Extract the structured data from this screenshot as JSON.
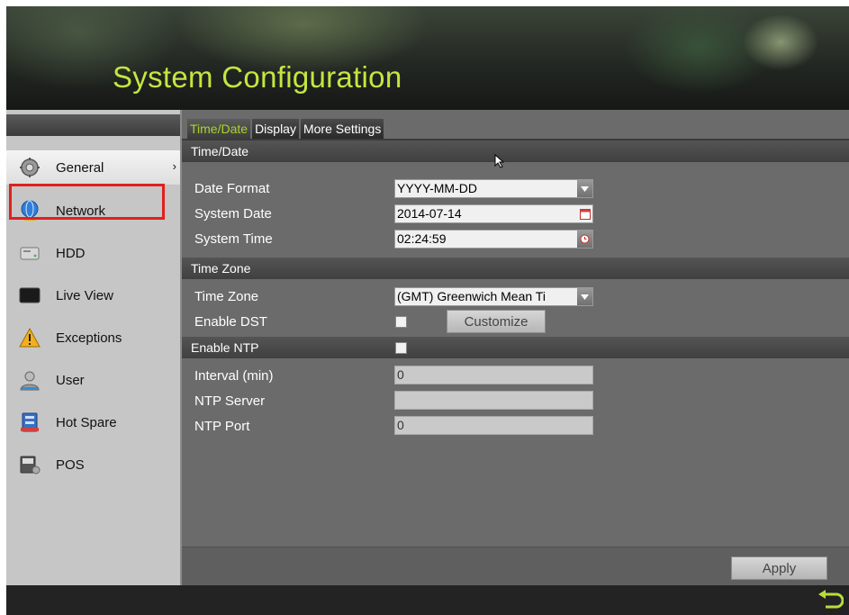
{
  "window": {
    "title": "System Configuration"
  },
  "sidebar": {
    "items": [
      {
        "label": "General",
        "icon": "gear-icon"
      },
      {
        "label": "Network",
        "icon": "globe-icon"
      },
      {
        "label": "HDD",
        "icon": "hdd-icon"
      },
      {
        "label": "Live View",
        "icon": "monitor-icon"
      },
      {
        "label": "Exceptions",
        "icon": "warning-icon"
      },
      {
        "label": "User",
        "icon": "user-icon"
      },
      {
        "label": "Hot Spare",
        "icon": "hot-spare-icon"
      },
      {
        "label": "POS",
        "icon": "pos-icon"
      }
    ],
    "active_item": "General",
    "highlighted_item": "Network"
  },
  "tabs": [
    "Time/Date",
    "Display",
    "More Settings"
  ],
  "sections": {
    "time_date": "Time/Date",
    "time_zone": "Time Zone",
    "enable_ntp": "Enable NTP"
  },
  "fields": {
    "date_format": {
      "label": "Date Format",
      "value": "YYYY-MM-DD"
    },
    "system_date": {
      "label": "System Date",
      "value": "2014-07-14"
    },
    "system_time": {
      "label": "System Time",
      "value": "02:24:59"
    },
    "time_zone": {
      "label": "Time Zone",
      "value": "(GMT) Greenwich Mean Ti"
    },
    "enable_dst": {
      "label": "Enable DST",
      "checked": false
    },
    "enable_ntp": {
      "checked": false
    },
    "interval": {
      "label": "Interval (min)",
      "value": "0"
    },
    "ntp_server": {
      "label": "NTP Server",
      "value": ""
    },
    "ntp_port": {
      "label": "NTP Port",
      "value": "0"
    }
  },
  "buttons": {
    "customize": "Customize",
    "apply": "Apply"
  },
  "colors": {
    "accent": "#c4e640",
    "tab_active": "#a8d428",
    "highlight": "#e02020"
  }
}
